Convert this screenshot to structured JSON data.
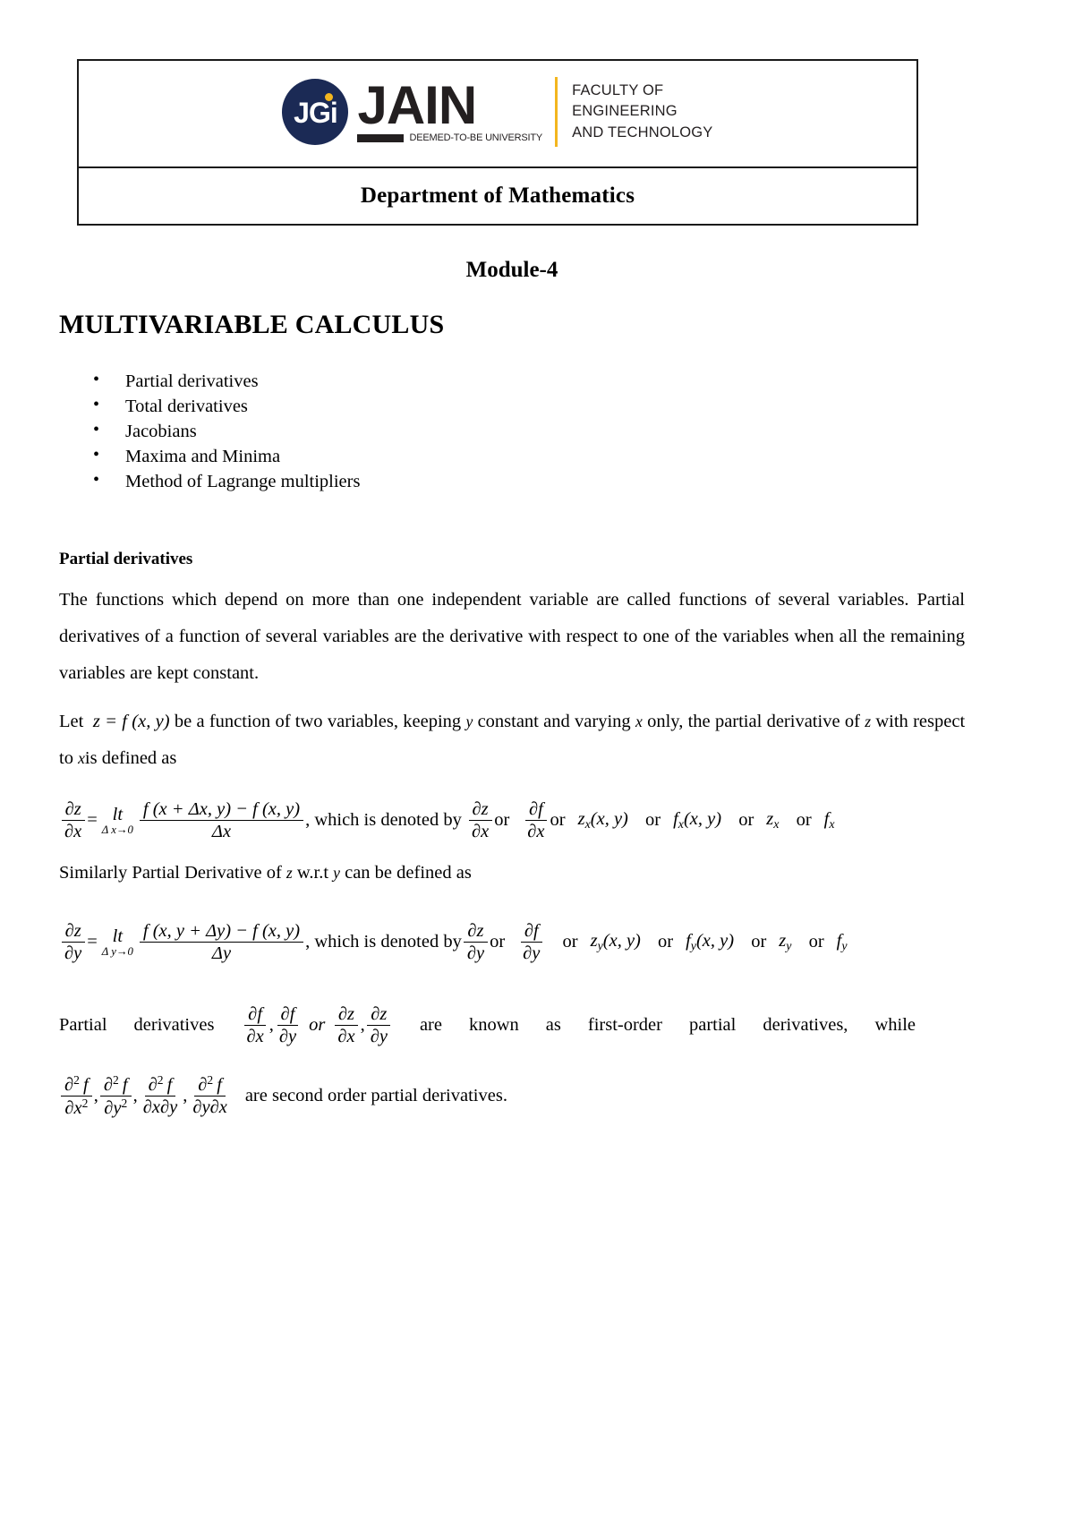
{
  "header": {
    "logo": {
      "badge_text": "JGi",
      "brand": "JAIN",
      "brand_sub": "DEEMED-TO-BE UNIVERSITY",
      "faculty_line1": "FACULTY OF",
      "faculty_line2": "ENGINEERING",
      "faculty_line3": "AND TECHNOLOGY",
      "navy": "#1b2a55",
      "yellow": "#f3b61f",
      "dark": "#231f20"
    },
    "department": "Department of Mathematics"
  },
  "module": {
    "label": "Module-4",
    "subject": "MULTIVARIABLE CALCULUS"
  },
  "topics": [
    "Partial derivatives",
    "Total derivatives",
    "Jacobians",
    "Maxima and Minima",
    "Method of Lagrange multipliers"
  ],
  "partial_derivatives": {
    "heading": "Partial derivatives",
    "para1": "The functions which depend on more than one independent variable are called functions of several variables. Partial derivatives of a function of several variables are the derivative with respect to one of the variables when all the remaining variables are kept constant.",
    "let_line": {
      "lead": "Let",
      "fn": "z = f (x, y)",
      "mid": "be a function of two variables, keeping",
      "var_y": "y",
      "mid2": "constant and varying",
      "var_x": "x",
      "tail": "only, the partial derivative of",
      "var_z": "z",
      "tail2": "with respect to",
      "var_x2": "x",
      "tail3": "is defined as"
    },
    "eq_x": {
      "lhs_num": "∂z",
      "lhs_den": "∂x",
      "equals": "=",
      "limit_op": "lt",
      "limit_sub": "Δ x→0",
      "rhs_num": "f (x + Δx, y) − f (x, y)",
      "rhs_den": "Δx",
      "denoted_text": ", which is denoted by",
      "notations": [
        "∂z/∂x",
        "∂f/∂x",
        "zₓ(x, y)",
        "fₓ(x, y)",
        "zₓ",
        "fₓ"
      ],
      "or_word": "or"
    },
    "similarly_line": {
      "lead": "Similarly Partial Derivative of",
      "var_z": "z",
      "mid": "w.r.t",
      "var_y": "y",
      "tail": "can be defined as"
    },
    "eq_y": {
      "lhs_num": "∂z",
      "lhs_den": "∂y",
      "equals": "=",
      "limit_op": "lt",
      "limit_sub": "Δ y→0",
      "rhs_num": "f (x, y + Δy) − f (x, y)",
      "rhs_den": "Δy",
      "denoted_text": ", which is denoted by",
      "notations": [
        "∂z/∂y",
        "∂f/∂y",
        "zᵧ(x, y)",
        "fᵧ(x, y)",
        "zᵧ",
        "fᵧ"
      ],
      "or_word": "or"
    },
    "orders_line": {
      "lead1": "Partial",
      "lead2": "derivatives",
      "or_word": "or",
      "known_as": "are",
      "known_as2": "known",
      "known_as3": "as",
      "first_order": "first-order",
      "partial_word": "partial",
      "derivatives_word": "derivatives,",
      "while_word": "while",
      "second_tail": "are second order partial derivatives."
    }
  }
}
